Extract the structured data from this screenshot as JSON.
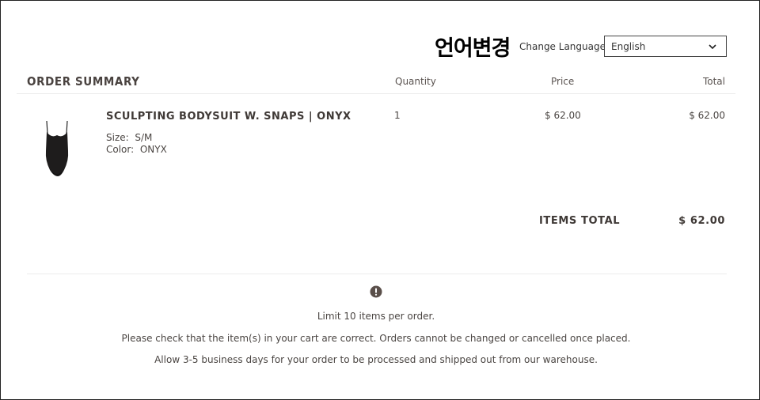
{
  "header": {
    "korean_label": "언어변경",
    "change_language_label": "Change Language",
    "language_select": {
      "selected": "English"
    }
  },
  "summary": {
    "title": "ORDER SUMMARY",
    "columns": {
      "quantity": "Quantity",
      "price": "Price",
      "total": "Total"
    }
  },
  "item": {
    "name": "SCULPTING BODYSUIT W. SNAPS | ONYX",
    "size_label": "Size:",
    "size_value": "S/M",
    "color_label": "Color:",
    "color_value": "ONYX",
    "quantity": "1",
    "price": "$ 62.00",
    "total": "$ 62.00",
    "image_icon": "bodysuit-image"
  },
  "totals": {
    "label": "ITEMS TOTAL",
    "value": "$ 62.00"
  },
  "notes": {
    "icon": "alert-icon",
    "limit": "Limit 10 items per order.",
    "check": "Please check that the item(s) in your cart are correct. Orders cannot be changed or cancelled once placed.",
    "processing": "Allow 3-5 business days for your order to be processed and shipped out from our warehouse."
  },
  "colors": {
    "text": "#3a3532",
    "alert_icon": "#5a4f4a",
    "border": "#222222"
  }
}
